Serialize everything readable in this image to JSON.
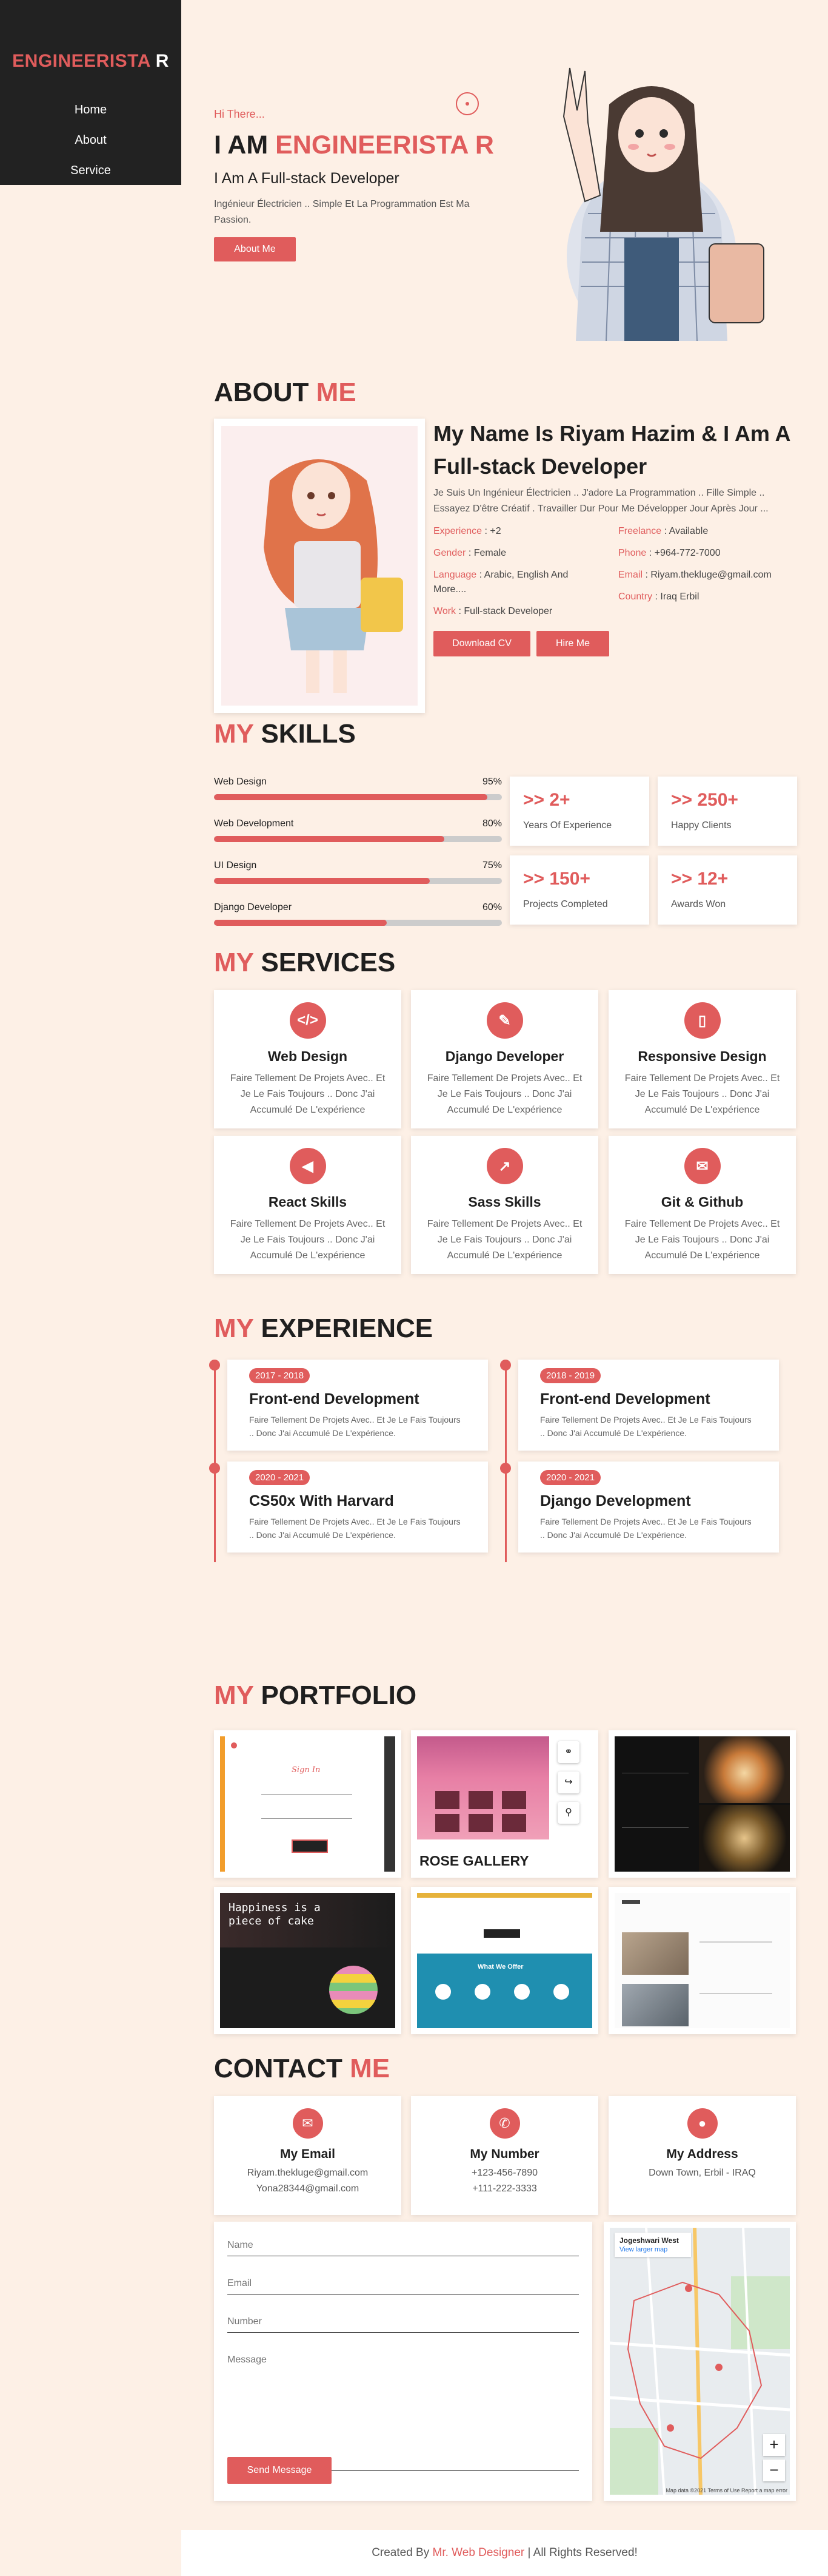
{
  "sidebar": {
    "brand": {
      "first": "ENGINEERISTA",
      "last": "R"
    },
    "nav": [
      "Home",
      "About",
      "Service"
    ]
  },
  "hero": {
    "greeting": "Hi There...",
    "title_prefix": "I AM",
    "title_name": "ENGINEERISTA R",
    "role": "I Am A Full-stack Developer",
    "description": "Ingénieur Électricien .. Simple Et La Programmation Est Ma Passion.",
    "button": "About Me"
  },
  "about": {
    "title_a": "ABOUT",
    "title_b": "ME",
    "heading": "My Name Is Riyam Hazim & I Am A Full-stack Developer",
    "intro": "Je Suis Un Ingénieur Électricien .. J'adore La Programmation .. Fille Simple .. Essayez D'être Créatif . Travailler Dur Pour Me Développer Jour Après Jour ...",
    "left": [
      {
        "k": "Experience",
        "v": ": +2"
      },
      {
        "k": "Gender",
        "v": ": Female"
      },
      {
        "k": "Language",
        "v": ": Arabic, English And More...."
      },
      {
        "k": "Work",
        "v": ": Full-stack Developer"
      }
    ],
    "right": [
      {
        "k": "Freelance",
        "v": ": Available"
      },
      {
        "k": "Phone",
        "v": ": +964-772-7000"
      },
      {
        "k": "Email",
        "v": ": Riyam.thekluge@gmail.com"
      },
      {
        "k": "Country",
        "v": ": Iraq Erbil"
      }
    ],
    "btn_cv": "Download CV",
    "btn_hire": "Hire Me"
  },
  "skills": {
    "title_a": "MY",
    "title_b": "SKILLS",
    "items": [
      {
        "name": "Web Design",
        "pct": "95%",
        "level": 0.95
      },
      {
        "name": "Web Development",
        "pct": "80%",
        "level": 0.8
      },
      {
        "name": "UI Design",
        "pct": "75%",
        "level": 0.75
      },
      {
        "name": "Django Developer",
        "pct": "60%",
        "level": 0.6
      }
    ],
    "stats": [
      {
        "num": ">> 2+",
        "cap": "Years Of Experience"
      },
      {
        "num": ">> 250+",
        "cap": "Happy Clients"
      },
      {
        "num": ">> 150+",
        "cap": "Projects Completed"
      },
      {
        "num": ">> 12+",
        "cap": "Awards Won"
      }
    ]
  },
  "services": {
    "title_a": "MY",
    "title_b": "SERVICES",
    "items": [
      {
        "icon": "code-icon",
        "title": "Web Design",
        "text": "Faire Tellement De Projets Avec.. Et Je Le Fais Toujours .. Donc J'ai Accumulé De L'expérience"
      },
      {
        "icon": "brush-icon",
        "title": "Django Developer",
        "text": "Faire Tellement De Projets Avec.. Et Je Le Fais Toujours .. Donc J'ai Accumulé De L'expérience"
      },
      {
        "icon": "mobile-icon",
        "title": "Responsive Design",
        "text": "Faire Tellement De Projets Avec.. Et Je Le Fais Toujours .. Donc J'ai Accumulé De L'expérience"
      },
      {
        "icon": "megaphone-icon",
        "title": "React Skills",
        "text": "Faire Tellement De Projets Avec.. Et Je Le Fais Toujours .. Donc J'ai Accumulé De L'expérience"
      },
      {
        "icon": "chart-icon",
        "title": "Sass Skills",
        "text": "Faire Tellement De Projets Avec.. Et Je Le Fais Toujours .. Donc J'ai Accumulé De L'expérience"
      },
      {
        "icon": "envelope-icon",
        "title": "Git & Github",
        "text": "Faire Tellement De Projets Avec.. Et Je Le Fais Toujours .. Donc J'ai Accumulé De L'expérience"
      }
    ]
  },
  "experience": {
    "title_a": "MY",
    "title_b": "EXPERIENCE",
    "items": [
      {
        "year": "2017 - 2018",
        "title": "Front-end Development",
        "text": "Faire Tellement De Projets Avec.. Et Je Le Fais Toujours .. Donc J'ai Accumulé De L'expérience."
      },
      {
        "year": "2018 - 2019",
        "title": "Front-end Development",
        "text": "Faire Tellement De Projets Avec.. Et Je Le Fais Toujours .. Donc J'ai Accumulé De L'expérience."
      },
      {
        "year": "2020 - 2021",
        "title": "CS50x With Harvard",
        "text": "Faire Tellement De Projets Avec.. Et Je Le Fais Toujours .. Donc J'ai Accumulé De L'expérience."
      },
      {
        "year": "2020 - 2021",
        "title": "Django Development",
        "text": "Faire Tellement De Projets Avec.. Et Je Le Fais Toujours .. Donc J'ai Accumulé De L'expérience."
      }
    ]
  },
  "portfolio": {
    "title_a": "MY",
    "title_b": "PORTFOLIO",
    "signin": "Sign In",
    "gallery_caption": "ROSE GALLERY",
    "happiness": "Happiness is a piece of cake",
    "offer_heading": "What We Offer"
  },
  "contact": {
    "title_a": "CONTACT",
    "title_b": "ME",
    "cards": [
      {
        "icon": "envelope-icon",
        "title": "My Email",
        "lines": [
          "Riyam.thekluge@gmail.com",
          "Yona28344@gmail.com"
        ]
      },
      {
        "icon": "phone-icon",
        "title": "My Number",
        "lines": [
          "+123-456-7890",
          "+111-222-3333"
        ]
      },
      {
        "icon": "map-pin-icon",
        "title": "My Address",
        "lines": [
          "Down Town, Erbil - IRAQ",
          ""
        ]
      }
    ],
    "form": {
      "name_ph": "Name",
      "email_ph": "Email",
      "number_ph": "Number",
      "message_ph": "Message",
      "send": "Send Message"
    },
    "map": {
      "place": "Jogeshwari West",
      "link": "View larger map",
      "attribution": "Map data ©2021  Terms of Use  Report a map error"
    }
  },
  "footer": {
    "prefix": "Created By",
    "author": "Mr. Web Designer",
    "suffix": "| All Rights Reserved!"
  },
  "colors": {
    "accent": "#e05c5c",
    "background": "#fdf0e6",
    "sidebar": "#222222"
  }
}
